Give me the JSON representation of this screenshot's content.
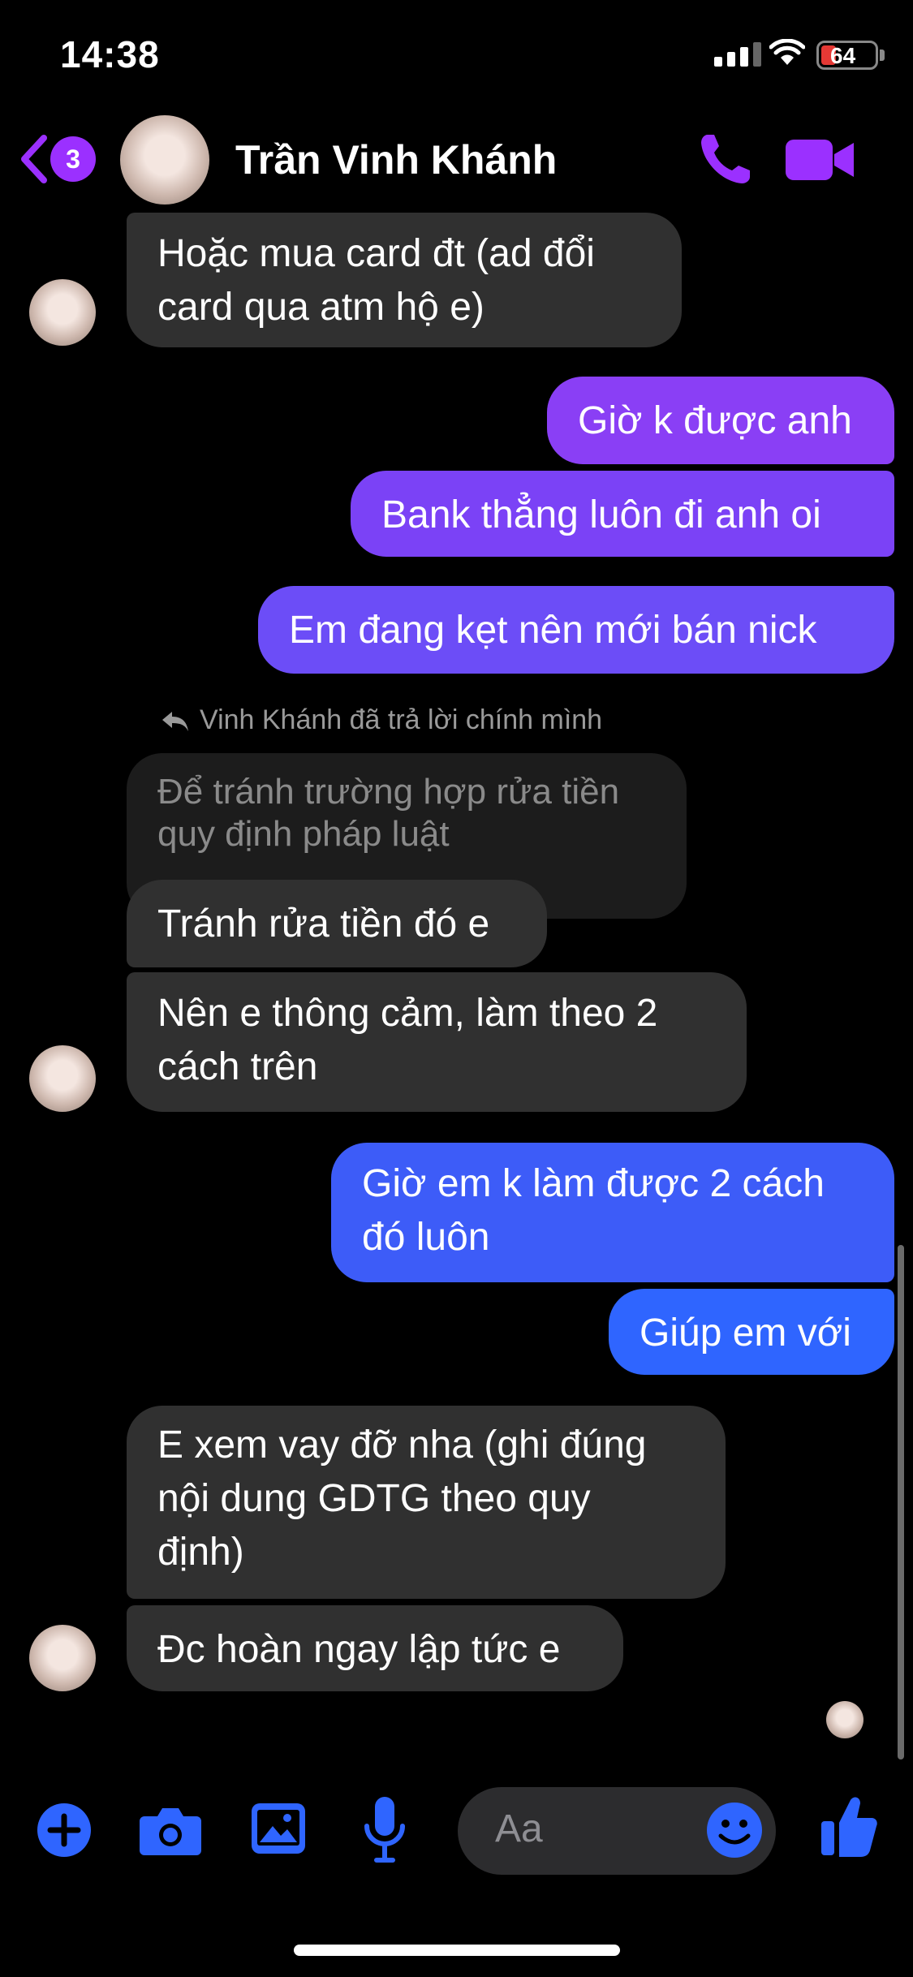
{
  "status_bar": {
    "time": "14:38",
    "battery": "64"
  },
  "header": {
    "unread_count": "3",
    "contact_name": "Trần Vinh Khánh"
  },
  "colors": {
    "accent": "#9b30ff",
    "blue": "#2f65ff",
    "bubble_left": "#303030"
  },
  "messages": [
    {
      "side": "left",
      "text": "Hoặc mua card đt (ad đổi\ncard qua atm hộ e)"
    },
    {
      "side": "right",
      "text": "Giờ k được anh"
    },
    {
      "side": "right",
      "text": "Bank thẳng luôn đi anh oi"
    },
    {
      "side": "right",
      "text": "Em đang kẹt nên mới bán nick"
    },
    {
      "side": "reply_note",
      "text": "Vinh Khánh đã trả lời chính mình"
    },
    {
      "side": "left_quoted",
      "text": "Để tránh trường hợp rửa tiền\nquy định pháp luật"
    },
    {
      "side": "left",
      "text": "Tránh rửa tiền đó e"
    },
    {
      "side": "left",
      "text": "Nên e thông cảm, làm theo 2\ncách trên"
    },
    {
      "side": "right",
      "text": "Giờ em k làm được 2 cách\nđó luôn"
    },
    {
      "side": "right",
      "text": "Giúp em với"
    },
    {
      "side": "left",
      "text": "E xem vay đỡ nha (ghi đúng\nnội dung GDTG theo quy\nđịnh)"
    },
    {
      "side": "left",
      "text": "Đc hoàn ngay lập tức e"
    }
  ],
  "composer": {
    "placeholder": "Aa"
  },
  "icons": [
    "back-chevron-icon",
    "phone-icon",
    "video-camera-icon",
    "plus-icon",
    "camera-icon",
    "gallery-icon",
    "microphone-icon",
    "emoji-icon",
    "thumbs-up-icon",
    "reply-arrow-icon"
  ]
}
